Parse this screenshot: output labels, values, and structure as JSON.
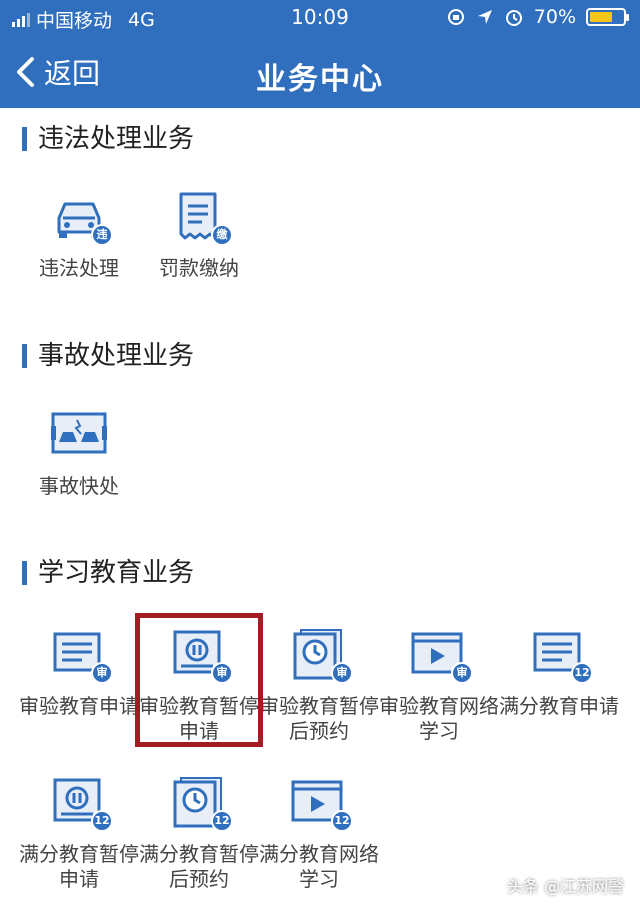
{
  "status_bar": {
    "carrier": "中国移动",
    "network": "4G",
    "time": "10:09",
    "battery": "70%",
    "battery_level": 0.7
  },
  "nav": {
    "back_label": "返回",
    "title": "业务中心"
  },
  "sections": [
    {
      "title": "违法处理业务",
      "items": [
        {
          "label": "违法处理",
          "icon": "car-icon",
          "badge": "违"
        },
        {
          "label": "罚款缴纳",
          "icon": "receipt-icon",
          "badge": "缴"
        }
      ]
    },
    {
      "title": "事故处理业务",
      "items": [
        {
          "label": "事故快处",
          "icon": "accident-icon",
          "badge": ""
        }
      ]
    },
    {
      "title": "学习教育业务",
      "items": [
        {
          "label": "审验教育申请",
          "icon": "form-icon",
          "badge": "审"
        },
        {
          "label": "审验教育暂停申请",
          "icon": "pause-icon",
          "badge": "审"
        },
        {
          "label": "审验教育暂停后预约",
          "icon": "clock-icon",
          "badge": "审"
        },
        {
          "label": "审验教育网络学习",
          "icon": "video-icon",
          "badge": "审"
        },
        {
          "label": "满分教育申请",
          "icon": "form-icon",
          "badge": "12"
        },
        {
          "label": "满分教育暂停申请",
          "icon": "pause-icon",
          "badge": "12"
        },
        {
          "label": "满分教育暂停后预约",
          "icon": "clock-icon",
          "badge": "12"
        },
        {
          "label": "满分教育网络学习",
          "icon": "video-icon",
          "badge": "12"
        }
      ]
    }
  ],
  "watermark": "头条 @江苏网警",
  "colors": {
    "primary": "#2f6fbe",
    "highlight": "#a31c24"
  }
}
